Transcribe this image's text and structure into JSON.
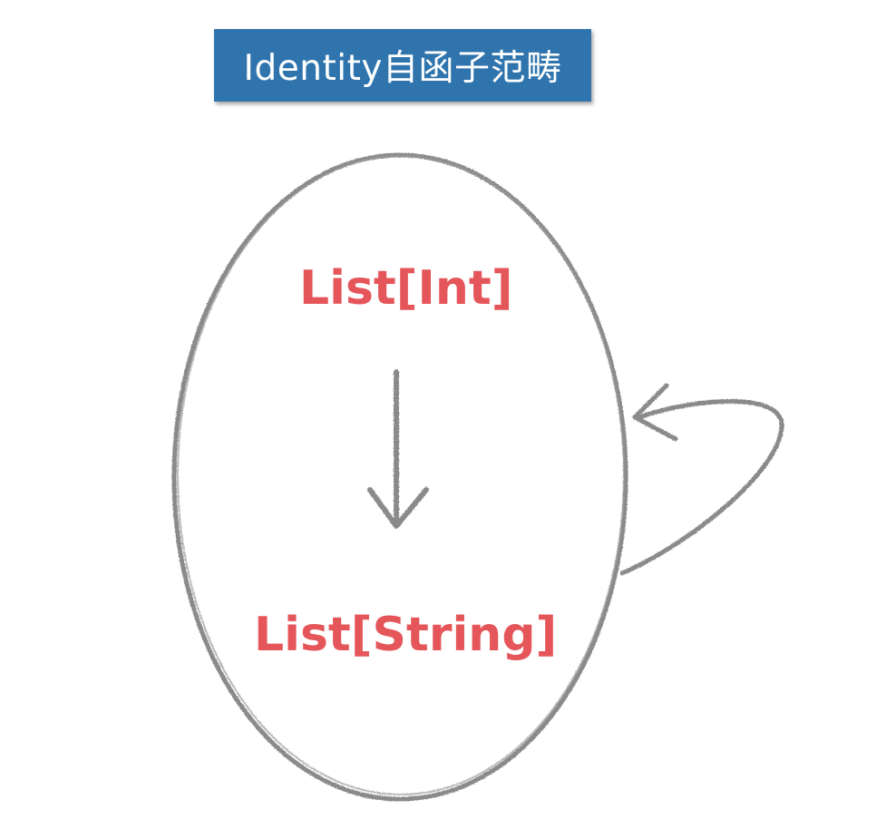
{
  "title": "Identity自函子范畴",
  "category": {
    "source_object": "List[Int]",
    "target_object": "List[String]"
  },
  "colors": {
    "title_background": "#2f74ad",
    "title_text": "#ffffff",
    "object_text": "#e5565a",
    "stroke": "#7d7d7d"
  }
}
